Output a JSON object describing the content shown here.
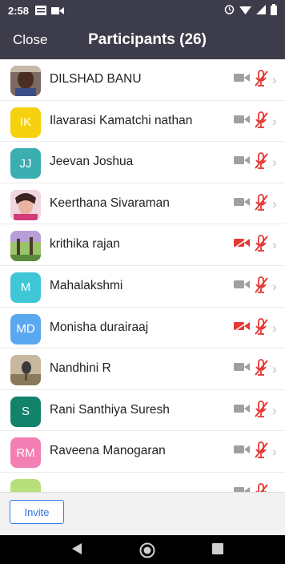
{
  "status": {
    "time": "2:58",
    "icons": [
      "message-icon",
      "video-icon",
      "alarm-icon",
      "wifi-icon",
      "signal-icon",
      "battery-icon"
    ]
  },
  "header": {
    "close_label": "Close",
    "title": "Participants (26)",
    "background": "#3c3c4a"
  },
  "participants": [
    {
      "name": "DILSHAD BANU",
      "avatar": "photo",
      "camera_off": false
    },
    {
      "name": "Ilavarasi Kamatchi nathan",
      "avatar": "IK",
      "color": "#f5d10f",
      "camera_off": false
    },
    {
      "name": "Jeevan Joshua",
      "avatar": "JJ",
      "color": "#3aaeb1",
      "camera_off": false
    },
    {
      "name": "Keerthana Sivaraman",
      "avatar": "photo",
      "camera_off": false
    },
    {
      "name": "krithika rajan",
      "avatar": "photo",
      "camera_off": true
    },
    {
      "name": "Mahalakshmi",
      "avatar": "M",
      "color": "#3fc6d7",
      "camera_off": false
    },
    {
      "name": "Monisha durairaaj",
      "avatar": "MD",
      "color": "#5aa9f0",
      "camera_off": true
    },
    {
      "name": "Nandhini R",
      "avatar": "photo",
      "camera_off": false
    },
    {
      "name": "Rani Santhiya Suresh",
      "avatar": "S",
      "color": "#12826a",
      "camera_off": false
    },
    {
      "name": "Raveena Manogaran",
      "avatar": "RM",
      "color": "#f37fb4",
      "camera_off": false
    }
  ],
  "bottom": {
    "invite_label": "Invite"
  },
  "colors": {
    "muted_red": "#e53935",
    "camera_gray": "#a0a0a0",
    "accent_blue": "#3170d6"
  }
}
